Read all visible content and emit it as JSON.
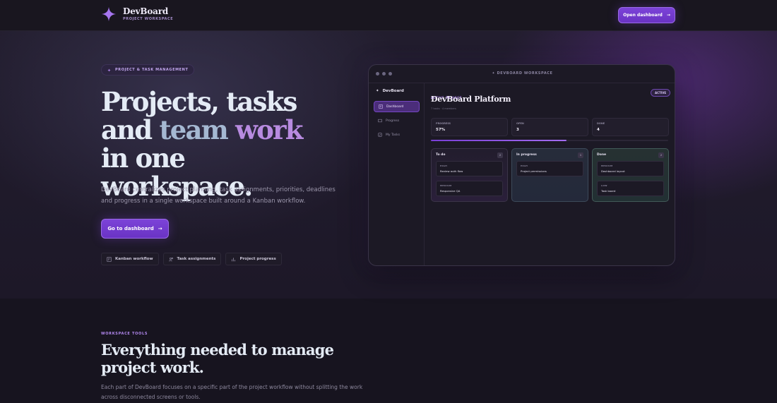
{
  "header": {
    "brand_name": "DevBoard",
    "brand_sub": "PROJECT WORKSPACE",
    "cta_label": "Open dashboard",
    "accent_color": "#7c43d8"
  },
  "hero": {
    "pill": "PROJECT & TASK MANAGEMENT",
    "title_line1": "Projects, tasks",
    "title_and": "and ",
    "title_team": "team ",
    "title_work": "work",
    "title_line3": "in one workspace.",
    "description": "DevBoard centralizes project planning, task assignments, priorities, deadlines and progress in a single workspace built around a Kanban workflow.",
    "cta_label": "Go to dashboard",
    "chips": [
      {
        "label": "Kanban workflow",
        "icon": "kanban-icon"
      },
      {
        "label": "Task assignments",
        "icon": "users-icon"
      },
      {
        "label": "Project progress",
        "icon": "bar-chart-icon"
      }
    ]
  },
  "mockup": {
    "window_title": "DEVBOARD WORKSPACE",
    "sidebar_brand": "DevBoard",
    "nav": [
      {
        "label": "Dashboard",
        "icon": "dashboard-icon"
      },
      {
        "label": "Progress",
        "icon": "progress-icon"
      },
      {
        "label": "My Tasks",
        "icon": "tasks-icon"
      }
    ],
    "active_label": "ACTIVE PROJECT",
    "project_name": "DevBoard Platform",
    "project_sub": "7 tasks · 4 members",
    "status_badge": "ACTIVE",
    "stats": [
      {
        "label": "PROGRESS",
        "value": "57%"
      },
      {
        "label": "OPEN",
        "value": "3"
      },
      {
        "label": "DONE",
        "value": "4"
      }
    ],
    "progress_fraction": 0.57,
    "columns": [
      {
        "title": "To do",
        "count": "2",
        "cards": [
          {
            "priority": "HIGH",
            "title": "Review auth flow"
          },
          {
            "priority": "MEDIUM",
            "title": "Responsive QA"
          }
        ]
      },
      {
        "title": "In progress",
        "count": "1",
        "cards": [
          {
            "priority": "HIGH",
            "title": "Project permissions"
          }
        ]
      },
      {
        "title": "Done",
        "count": "2",
        "cards": [
          {
            "priority": "MEDIUM",
            "title": "Dashboard layout"
          },
          {
            "priority": "LOW",
            "title": "Task board"
          }
        ]
      }
    ]
  },
  "tools": {
    "label": "WORKSPACE TOOLS",
    "title": "Everything needed to manage project work.",
    "description": "Each part of DevBoard focuses on a specific part of the project workflow without splitting the work across disconnected screens or tools."
  }
}
